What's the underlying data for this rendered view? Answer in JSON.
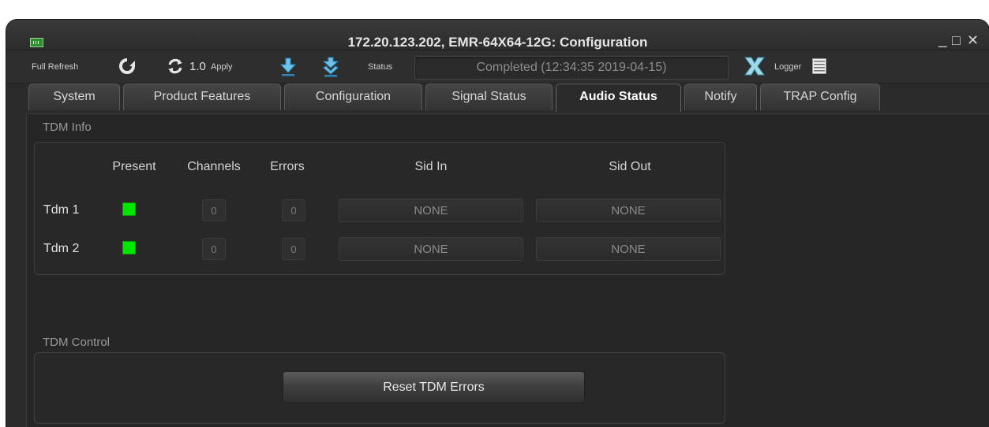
{
  "window": {
    "title": "172.20.123.202, EMR-64X64-12G: Configuration",
    "controls": {
      "minimize": "_",
      "maximize": "□",
      "close": "✕"
    }
  },
  "toolbar": {
    "full_refresh_label": "Full Refresh",
    "version_label": "1.0",
    "apply_label": "Apply",
    "status_label": "Status",
    "status_value": "Completed  (12:34:35 2019-04-15)",
    "logger_label": "Logger"
  },
  "tabs": [
    {
      "label": "System"
    },
    {
      "label": "Product Features"
    },
    {
      "label": "Configuration"
    },
    {
      "label": "Signal Status"
    },
    {
      "label": "Audio Status"
    },
    {
      "label": "Notify"
    },
    {
      "label": "TRAP Config"
    }
  ],
  "active_tab": "Audio Status",
  "tdm_info": {
    "title": "TDM Info",
    "headers": {
      "present": "Present",
      "channels": "Channels",
      "errors": "Errors",
      "sid_in": "Sid In",
      "sid_out": "Sid Out"
    },
    "rows": [
      {
        "label": "Tdm 1",
        "present": true,
        "channels": "0",
        "errors": "0",
        "sid_in": "NONE",
        "sid_out": "NONE"
      },
      {
        "label": "Tdm 2",
        "present": true,
        "channels": "0",
        "errors": "0",
        "sid_in": "NONE",
        "sid_out": "NONE"
      }
    ]
  },
  "tdm_control": {
    "title": "TDM Control",
    "reset_label": "Reset TDM Errors"
  },
  "colors": {
    "led_present": "#00e600",
    "accent_blue": "#3fa9e0",
    "background": "#262626"
  }
}
